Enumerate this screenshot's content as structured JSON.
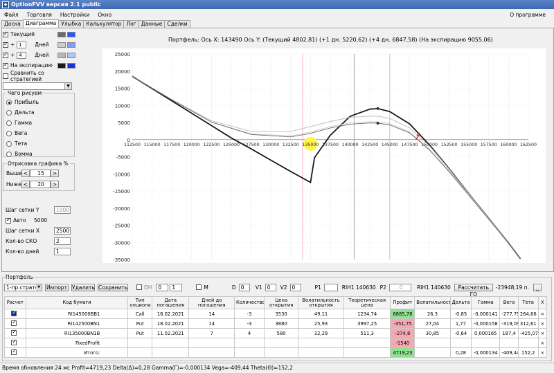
{
  "window": {
    "title": "OptionFVV версия 2.1 public",
    "icon": "app-icon"
  },
  "menu": {
    "items": [
      "Файл",
      "Торговля",
      "Настройки",
      "Окно"
    ],
    "about": "О программе"
  },
  "tabs": [
    "Доска",
    "Диаграмма",
    "Улыбка",
    "Калькулятор",
    "Лог",
    "Данные",
    "Сделки"
  ],
  "left": {
    "current_label": "Текущий",
    "plus_label": "+",
    "day1_value": "1",
    "day2_value": "4",
    "days_label": "Дней",
    "expiration_label": "На экспирацию",
    "compare_label": "Сравнить со стратегией",
    "what_group": "Чего рисуем",
    "radios": [
      "Прибыль",
      "Дельта",
      "Гамма",
      "Вега",
      "Тета",
      "Вомма"
    ],
    "draw_group": "Отрисовка графика %",
    "above_label": "Выше",
    "above_value": "15",
    "below_label": "Ниже",
    "below_value": "20",
    "grid_y_label": "Шаг сетки Y",
    "grid_y_value": "1000",
    "auto_label": "Авто",
    "auto_value": "5000",
    "grid_x_label": "Шаг сетки X",
    "grid_x_value": "2500",
    "sko_label": "Кол-во СКО",
    "sko_value": "2",
    "days_count_label": "Кол-во дней",
    "days_count_value": "1"
  },
  "chart_title": "Портфель: Ось X: 143490 Ось Y:  (Текущий 4802,81)  (+1 дн. 5220,62)  (+4 дн. 6847,58)  (На экспирацию 9055,06)",
  "chart_data": {
    "type": "line",
    "xlim": [
      112500,
      162500
    ],
    "ylim": [
      -35000,
      25000
    ],
    "x_ticks": [
      112500,
      115000,
      117500,
      120000,
      122500,
      125000,
      127500,
      130000,
      132500,
      135000,
      137500,
      140000,
      142500,
      145000,
      147500,
      150000,
      152500,
      155000,
      157500,
      160000,
      162500
    ],
    "y_ticks": [
      25000,
      20000,
      15000,
      10000,
      5000,
      0,
      -5000,
      -10000,
      -15000,
      -20000,
      -25000,
      -30000,
      -35000
    ],
    "vlines": {
      "gray": [
        140500
      ],
      "pink": [
        134000,
        145000
      ]
    },
    "cursor": [
      143490,
      4802.81
    ],
    "markers": [
      [
        143490,
        9055
      ],
      [
        143490,
        4800
      ]
    ],
    "series": [
      {
        "x": [
          112500,
          115000,
          117500,
          120000,
          122500,
          125000,
          127500,
          130000,
          132500,
          135000,
          135500,
          137500,
          140000,
          142500,
          143500,
          145000,
          147500,
          150000,
          152500,
          155000,
          157500,
          160000,
          161500
        ],
        "values": [
          18500,
          14900,
          11300,
          7700,
          4100,
          500,
          -2700,
          -6000,
          -9300,
          -12500,
          -5300,
          1300,
          6800,
          8900,
          9055,
          8200,
          4600,
          -1500,
          -8500,
          -15800,
          -23000,
          -30200,
          -34800
        ]
      },
      {
        "x": [
          112500,
          117500,
          122500,
          127500,
          132500,
          135000,
          137500,
          140000,
          142500,
          143500,
          145000,
          147500,
          150000,
          152500,
          155000,
          157500,
          160000,
          161500
        ],
        "values": [
          18500,
          11700,
          5500,
          2400,
          2400,
          3800,
          5300,
          6500,
          6850,
          6848,
          6200,
          3400,
          -1800,
          -8600,
          -15800,
          -23000,
          -30200,
          -34800
        ]
      },
      {
        "x": [
          112500,
          117500,
          122500,
          127500,
          132500,
          135000,
          137500,
          140000,
          142500,
          143500,
          145000,
          147500,
          150000,
          152500,
          155000,
          157500,
          160000,
          161500
        ],
        "values": [
          18500,
          11600,
          5200,
          1700,
          1100,
          2200,
          3800,
          4900,
          5250,
          5221,
          4700,
          2300,
          -2700,
          -9100,
          -16100,
          -23200,
          -30300,
          -34800
        ]
      },
      {
        "x": [
          112500,
          117500,
          122500,
          127500,
          132500,
          135000,
          137500,
          140000,
          142500,
          143500,
          145000,
          147500,
          150000,
          152500,
          155000,
          157500,
          160000,
          161500
        ],
        "values": [
          18500,
          11600,
          5100,
          1500,
          800,
          1800,
          3400,
          4500,
          4850,
          4803,
          4300,
          2000,
          -3000,
          -9400,
          -16300,
          -23300,
          -30300,
          -34800
        ]
      }
    ]
  },
  "portfolio": {
    "title": "Портфель",
    "strategy": "1-пр.страте",
    "import": "Импорт",
    "delete": "Удалить",
    "save": "Сохранить",
    "dh": "DH",
    "dh_v1": "0",
    "dh_v2": "1",
    "m": "M",
    "d_label": "D",
    "d_value": "0",
    "v1_label": "V1",
    "v1_value": "0",
    "v2_label": "V2",
    "v2_value": "0",
    "p1_label": "P1",
    "p1_value": "",
    "p1_name": "RIH1 140630",
    "p2_label": "P2",
    "p2_value": "0",
    "p2_name": "RIH1 140630",
    "go_button": "Рассчитать ГО",
    "go_value": "-23948,19 п."
  },
  "table": {
    "headers": [
      "Расчет",
      "Код бумаги",
      "Тип опциона",
      "Дата погашения",
      "Дней до погашения",
      "Количество",
      "Цена открытия",
      "Волатильность открытия",
      "Теоретическая цена",
      "Профит",
      "Волатильность",
      "Дельта",
      "Гамма",
      "Вега",
      "Тета",
      "X"
    ],
    "rows": [
      [
        "",
        "RI145000BB1",
        "Call",
        "18.02.2021",
        "14",
        "-3",
        "3530",
        "49,11",
        "1234,74",
        "6885,78",
        "26,3",
        "-0,85",
        "-0,000141",
        "-277,75",
        "264,66",
        "×"
      ],
      [
        "",
        "RI142500BN1",
        "Put",
        "18.02.2021",
        "14",
        "-3",
        "3880",
        "25,93",
        "3997,25",
        "-351,75",
        "27,04",
        "1,77",
        "-0,000158",
        "-319,09",
        "312,61",
        "×"
      ],
      [
        "",
        "RI135000BN1B",
        "Put",
        "11.02.2021",
        "7",
        "4",
        "580",
        "32,29",
        "511,3",
        "-274,8",
        "30,85",
        "-0,64",
        "0,000165",
        "187,4",
        "-425,07",
        "×"
      ],
      [
        "",
        "FixedProfit",
        "",
        "",
        "",
        "",
        "",
        "",
        "",
        "-1540",
        "",
        "",
        "",
        "",
        "",
        "×"
      ],
      [
        "",
        "Итого:",
        "",
        "",
        "",
        "",
        "",
        "",
        "",
        "4719,23",
        "",
        "0,28",
        "-0,000134",
        "-409,44",
        "152,2",
        "×"
      ]
    ]
  },
  "status": "Время обновления 24 мс  Profit=4719,23 Delta(Δ)=0,28 Gamma(Γ)=-0,000134 Vega=-409,44 Theta(Θ)=152,2",
  "colors": {
    "current": "#6a6a6a",
    "day1": "#cccccc",
    "day4": "#b8b8b8",
    "expiration": "#1a1a1a"
  }
}
